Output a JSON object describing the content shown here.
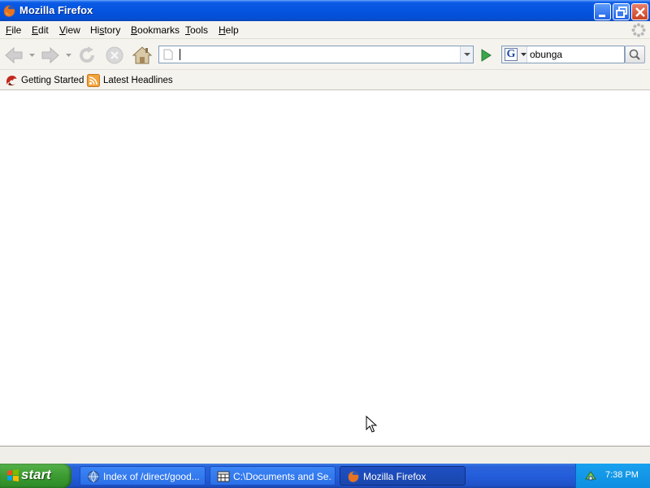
{
  "window": {
    "title": "Mozilla Firefox"
  },
  "menu": {
    "items": [
      {
        "label_u": "F",
        "label_rest": "ile"
      },
      {
        "label_u": "E",
        "label_rest": "dit"
      },
      {
        "label_u": "V",
        "label_rest": "iew"
      },
      {
        "label_pre": "Hi",
        "label_u": "s",
        "label_rest": "tory"
      },
      {
        "label_u": "B",
        "label_rest": "ookmarks"
      },
      {
        "label_u": "T",
        "label_rest": "ools"
      },
      {
        "label_u": "H",
        "label_rest": "elp"
      }
    ]
  },
  "navigation": {
    "url_value": "",
    "search_value": "obunga",
    "search_engine_letter": "G"
  },
  "bookmarks": {
    "items": [
      {
        "label": "Getting Started",
        "icon": "firefox-bookmark-icon"
      },
      {
        "label": "Latest Headlines",
        "icon": "rss-feed-icon"
      }
    ]
  },
  "status": {
    "text": ""
  },
  "taskbar": {
    "start_label": "start",
    "tasks": [
      {
        "label": "Index of /direct/good...",
        "icon": "browser-globe-icon",
        "active": false
      },
      {
        "label": "C:\\Documents and Se...",
        "icon": "folder-window-icon",
        "active": false
      },
      {
        "label": "Mozilla Firefox",
        "icon": "firefox-icon",
        "active": true
      }
    ],
    "clock": "7:38 PM"
  },
  "colors": {
    "titlebar": "#0554e0",
    "taskbar": "#245edb",
    "start_button": "#3c9b32",
    "toolbar_bg": "#f5f3ee"
  }
}
